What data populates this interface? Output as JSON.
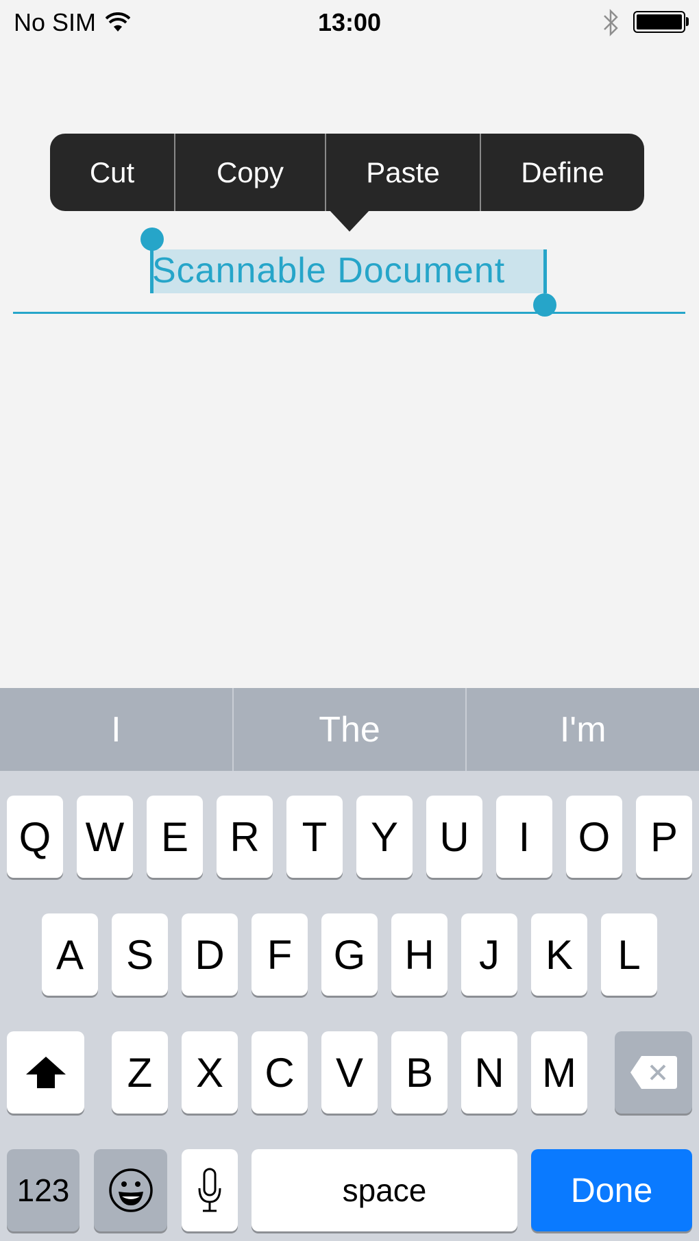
{
  "status_bar": {
    "carrier": "No SIM",
    "time": "13:00",
    "icons": [
      "wifi-icon",
      "bluetooth-icon",
      "battery-icon"
    ]
  },
  "edit_menu": {
    "items": [
      {
        "label": "Cut"
      },
      {
        "label": "Copy"
      },
      {
        "label": "Paste"
      },
      {
        "label": "Define"
      }
    ]
  },
  "text_field": {
    "value": "Scannable Document",
    "selected_text": "Scannable Document",
    "accent_color": "#26a5c9"
  },
  "keyboard": {
    "suggestions": [
      "I",
      "The",
      "I'm"
    ],
    "row1": [
      "Q",
      "W",
      "E",
      "R",
      "T",
      "Y",
      "U",
      "I",
      "O",
      "P"
    ],
    "row2": [
      "A",
      "S",
      "D",
      "F",
      "G",
      "H",
      "J",
      "K",
      "L"
    ],
    "row3": [
      "Z",
      "X",
      "C",
      "V",
      "B",
      "N",
      "M"
    ],
    "numbers_label": "123",
    "space_label": "space",
    "done_label": "Done",
    "done_color": "#0a7aff",
    "icons": {
      "shift": "shift-icon",
      "delete": "delete-icon",
      "emoji": "emoji-icon",
      "mic": "microphone-icon"
    }
  }
}
